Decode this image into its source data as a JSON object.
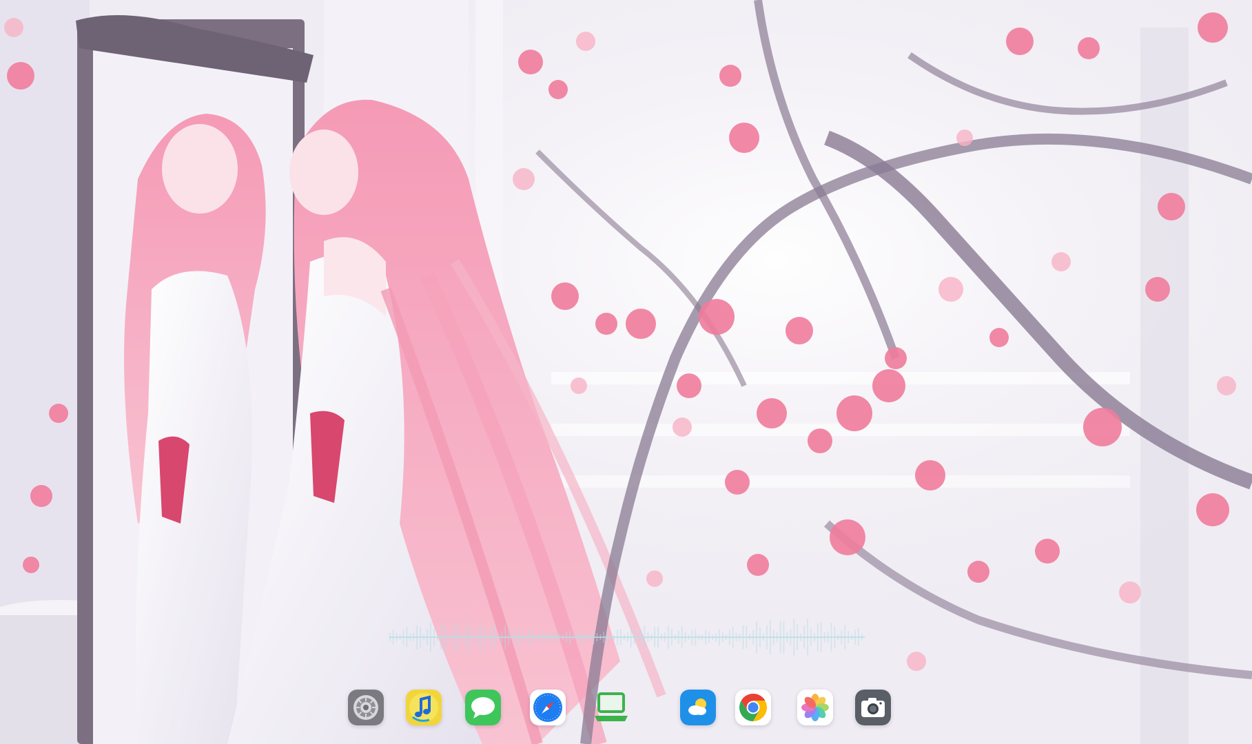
{
  "wallpaper": {
    "name": "cherry-blossom-mirror-wallpaper",
    "colors": {
      "background": "#f1eef5",
      "blossom": "#f07c9c",
      "blossom_light": "#f7b3c6",
      "branch": "#8a7b93",
      "hair": "#f4a3bd",
      "dress": "#fbfafd",
      "mirror_frame": "#7d6f82"
    }
  },
  "visualizer": {
    "color": "#b8dde6",
    "level": 0.55
  },
  "dock": {
    "items": [
      {
        "name": "system-settings",
        "icon": "settings-gear-icon",
        "color": "#6f6f73"
      },
      {
        "name": "music",
        "icon": "music-note-icon",
        "color": "#f1d53a"
      },
      {
        "name": "messages",
        "icon": "chat-bubble-icon",
        "color": "#3ec65b"
      },
      {
        "name": "safari",
        "icon": "compass-icon",
        "color": "#1e7df0"
      },
      {
        "name": "remote-desktop",
        "icon": "laptop-icon",
        "color": "#3bb34a"
      },
      {
        "name": "weather",
        "icon": "cloud-sun-icon",
        "color": "#1f90e8"
      },
      {
        "name": "chrome",
        "icon": "chrome-icon",
        "color": "#e94235"
      },
      {
        "name": "photos",
        "icon": "photos-flower-icon",
        "color": "#f6a623"
      },
      {
        "name": "camera",
        "icon": "camera-icon",
        "color": "#4b4f57"
      }
    ]
  }
}
